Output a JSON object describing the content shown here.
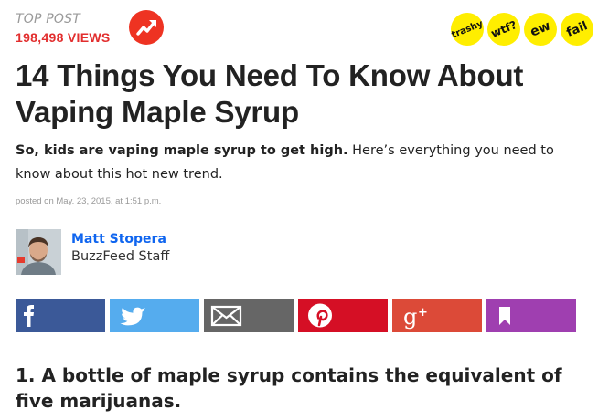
{
  "header": {
    "top_post_label": "TOP POST",
    "views": "198,498 VIEWS",
    "trend_icon": "trending-arrow-icon"
  },
  "reactions": [
    {
      "label": "trashy",
      "color": "#ffee00"
    },
    {
      "label": "wtf?",
      "color": "#ffee00"
    },
    {
      "label": "ew",
      "color": "#ffee00"
    },
    {
      "label": "fail",
      "color": "#ffee00"
    }
  ],
  "article": {
    "title": "14 Things You Need To Know About Vaping Maple Syrup",
    "dek_bold": "So, kids are vaping maple syrup to get high.",
    "dek_rest": " Here’s everything you need to know about this hot new trend.",
    "posted": "posted on May. 23, 2015, at 1:51 p.m."
  },
  "author": {
    "name": "Matt Stopera",
    "role": "BuzzFeed Staff"
  },
  "share_buttons": [
    {
      "network": "facebook",
      "icon": "facebook-icon",
      "color": "#3b5998"
    },
    {
      "network": "twitter",
      "icon": "twitter-icon",
      "color": "#55acee"
    },
    {
      "network": "email",
      "icon": "mail-icon",
      "color": "#666666"
    },
    {
      "network": "pinterest",
      "icon": "pinterest-icon",
      "color": "#d50f25"
    },
    {
      "network": "google-plus",
      "icon": "google-plus-icon",
      "color": "#dc4a38"
    },
    {
      "network": "bookmark",
      "icon": "bookmark-icon",
      "color": "#9f3fb0"
    }
  ],
  "first_item": {
    "heading": "1. A bottle of maple syrup contains the equivalent of five marijuanas."
  }
}
